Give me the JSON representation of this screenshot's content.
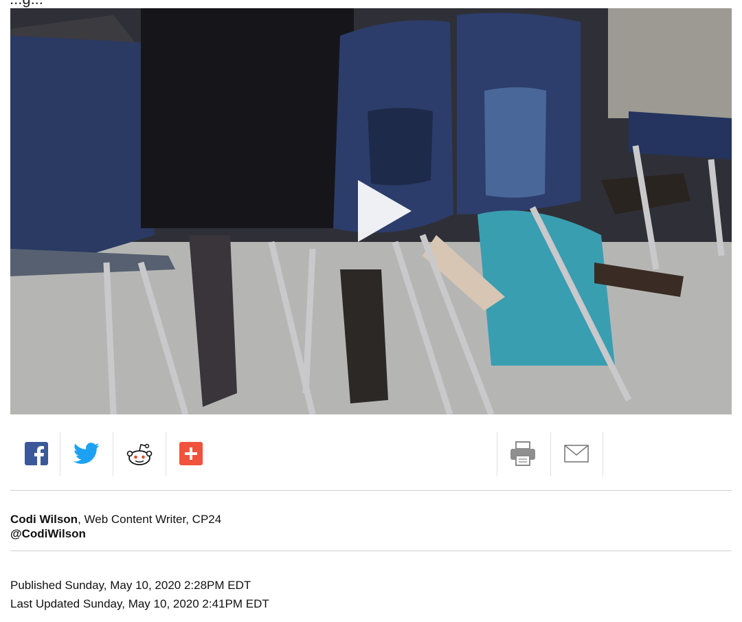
{
  "page": {
    "cutoff_heading": "...g..."
  },
  "video": {
    "play_label": "Play video"
  },
  "share": {
    "facebook_icon": "facebook-icon",
    "twitter_icon": "twitter-icon",
    "reddit_icon": "reddit-icon",
    "more_icon": "plus-icon",
    "print_icon": "print-icon",
    "email_icon": "email-icon",
    "colors": {
      "facebook": "#3b5998",
      "twitter": "#1da1f2",
      "more": "#f0523b"
    }
  },
  "author": {
    "name": "Codi Wilson",
    "title": ", Web Content Writer, CP24",
    "handle": "@CodiWilson"
  },
  "dates": {
    "published": "Published Sunday, May 10, 2020 2:28PM EDT",
    "updated": "Last Updated Sunday, May 10, 2020 2:41PM EDT"
  }
}
